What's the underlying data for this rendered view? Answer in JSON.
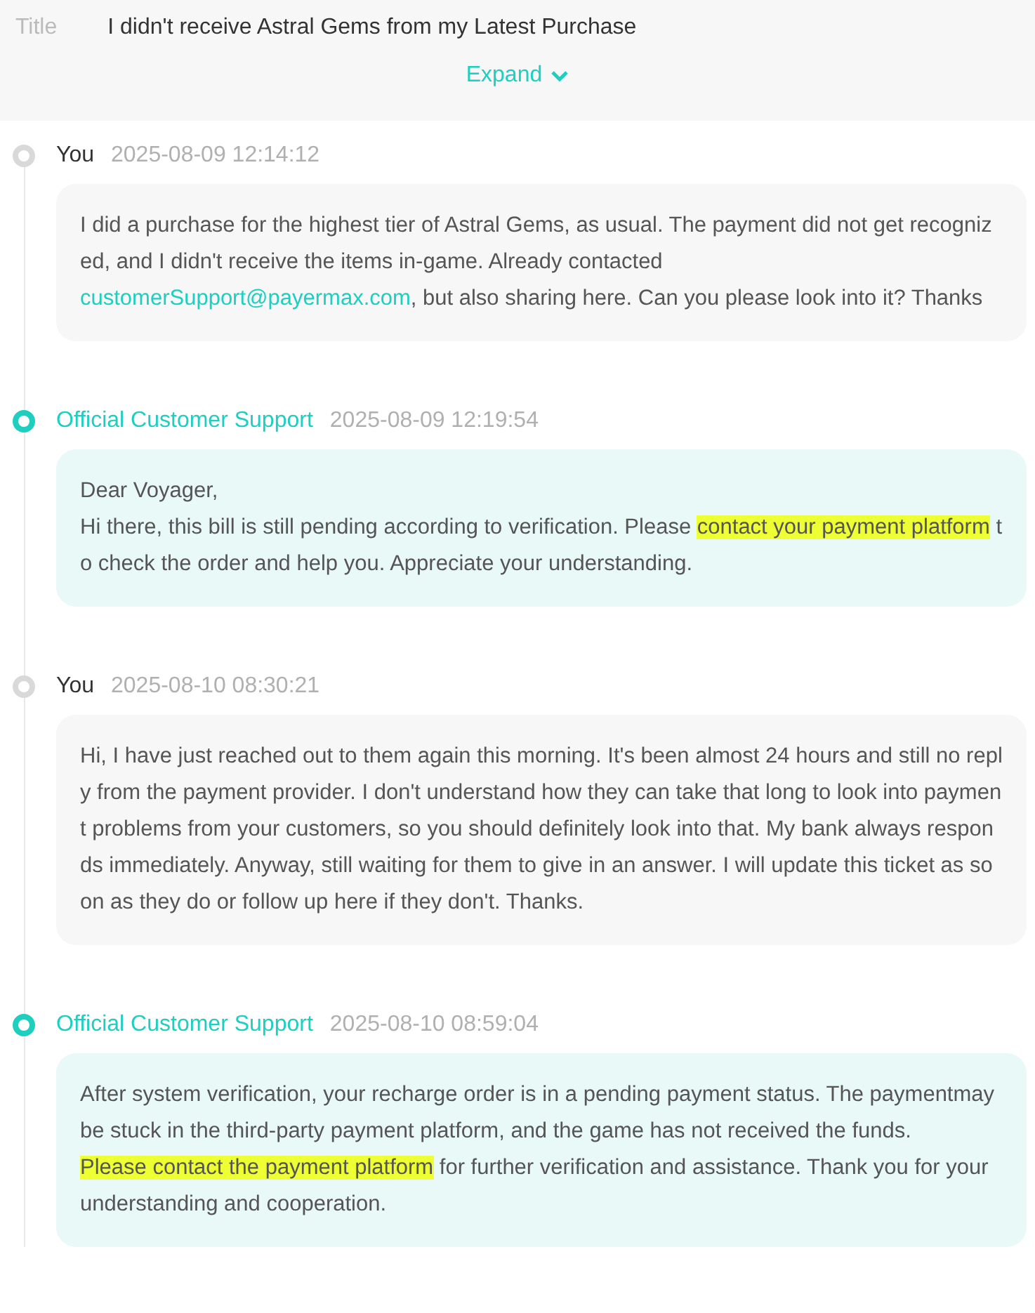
{
  "header": {
    "title_label": "Title",
    "title": "I didn't receive Astral Gems from my Latest Purchase",
    "expand": "Expand"
  },
  "messages": [
    {
      "kind": "user",
      "author": "You",
      "time": "2025-08-09 12:14:12",
      "segments": [
        {
          "kind": "text",
          "text": "I did a purchase for the highest tier of Astral Gems, as usual. The payment did not get recognized, and I didn't receive the items in-game. Already contacted "
        },
        {
          "kind": "link",
          "text": "customerSupport@payermax.com"
        },
        {
          "kind": "text",
          "text": ", but also sharing here. Can you please look into it? Thanks"
        }
      ]
    },
    {
      "kind": "support",
      "author": "Official Customer Support",
      "time": "2025-08-09 12:19:54",
      "segments": [
        {
          "kind": "text",
          "text": "Dear Voyager,\nHi there, this bill is still pending according to verification. Please "
        },
        {
          "kind": "highlight",
          "text": "contact your payment platform"
        },
        {
          "kind": "text",
          "text": " to check the order and help you. Appreciate your understanding."
        }
      ]
    },
    {
      "kind": "user",
      "author": "You",
      "time": "2025-08-10 08:30:21",
      "segments": [
        {
          "kind": "text",
          "text": "Hi, I have just reached out to them again this morning. It's been almost 24 hours and still no reply from the payment provider. I don't understand how they can take that long to look into payment problems from your customers, so you should definitely look into that. My bank always responds immediately. Anyway, still waiting for them to give in an answer. I will update this ticket as soon as they do or follow up here if they don't. Thanks."
        }
      ]
    },
    {
      "kind": "support",
      "author": "Official Customer Support",
      "time": "2025-08-10 08:59:04",
      "segments": [
        {
          "kind": "text",
          "text": "After system verification, your recharge order is in a pending payment status. The paymentmay be stuck in the third-party payment platform, and the game has not received the funds. "
        },
        {
          "kind": "highlight",
          "text": "Please contact the payment platform"
        },
        {
          "kind": "text",
          "text": " for further verification and assistance. Thank you for your understanding and cooperation."
        }
      ]
    }
  ]
}
